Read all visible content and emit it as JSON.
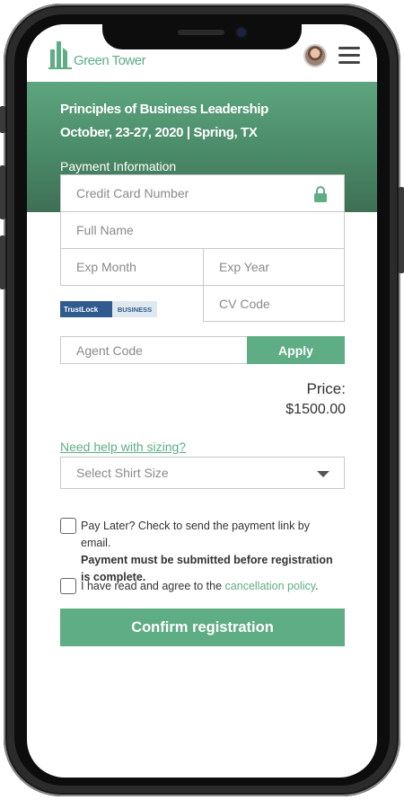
{
  "brand": {
    "name": "Green Tower",
    "accent": "#5fad84"
  },
  "event": {
    "title": "Principles of Business Leadership",
    "date_location": "October, 23-27, 2020 | Spring, TX"
  },
  "payment": {
    "section_label": "Payment Information",
    "card_number_placeholder": "Credit Card Number",
    "full_name_placeholder": "Full Name",
    "exp_month_placeholder": "Exp Month",
    "exp_year_placeholder": "Exp Year",
    "cv_code_placeholder": "CV Code",
    "trust_badge": {
      "left": "TrustLock",
      "right": "BUSINESS"
    }
  },
  "agent": {
    "placeholder": "Agent Code",
    "apply_label": "Apply"
  },
  "price": {
    "label": "Price:",
    "value": "$1500.00"
  },
  "sizing": {
    "help_link": "Need help with sizing?",
    "select_placeholder": "Select Shirt Size"
  },
  "pay_later": {
    "line1": "Pay Later? Check to send the payment link by email.",
    "line2": "Payment must be submitted before registration",
    "line3": "is complete."
  },
  "agree": {
    "prefix": "I have read and agree to the ",
    "link": "cancellation policy",
    "suffix": "."
  },
  "confirm_label": "Confirm registration"
}
